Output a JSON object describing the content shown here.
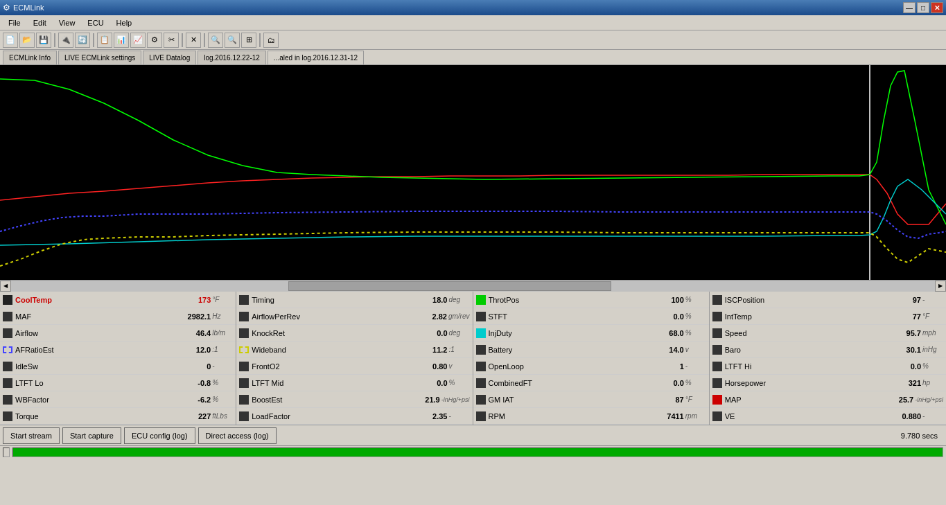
{
  "titlebar": {
    "title": "ECMLink",
    "min_label": "—",
    "max_label": "□",
    "close_label": "✕"
  },
  "menu": {
    "items": [
      "File",
      "Edit",
      "View",
      "ECU",
      "Help"
    ]
  },
  "tabs": [
    {
      "id": "ecmlink-info",
      "label": "ECMLink Info",
      "active": false
    },
    {
      "id": "live-settings",
      "label": "LIVE ECMLink settings",
      "active": false
    },
    {
      "id": "live-datalog",
      "label": "LIVE Datalog",
      "active": false
    },
    {
      "id": "log-dec22",
      "label": "log.2016.12.22-12",
      "active": false
    },
    {
      "id": "log-dec31",
      "label": "...aled in log.2016.12.31-12",
      "active": true
    }
  ],
  "data_fields": {
    "col1": [
      {
        "label": "CoolTemp",
        "value": "173",
        "unit": "°F",
        "highlight": true,
        "box_color": "dark"
      },
      {
        "label": "MAF",
        "value": "2982.1",
        "unit": "Hz",
        "highlight": false,
        "box_color": "dark"
      },
      {
        "label": "Airflow",
        "value": "46.4",
        "unit": "lb/m",
        "highlight": false,
        "box_color": "dark"
      },
      {
        "label": "AFRatioEst",
        "value": "12.0",
        "unit": ":1",
        "highlight": false,
        "box_color": "blue-dot"
      },
      {
        "label": "IdleSw",
        "value": "0",
        "unit": "-",
        "highlight": false,
        "box_color": "dark"
      },
      {
        "label": "LTFT Lo",
        "value": "-0.8",
        "unit": "%",
        "highlight": false,
        "box_color": "dark"
      },
      {
        "label": "WBFactor",
        "value": "-6.2",
        "unit": "%",
        "highlight": false,
        "box_color": "dark"
      },
      {
        "label": "Torque",
        "value": "227",
        "unit": "ftLbs",
        "highlight": false,
        "box_color": "dark"
      }
    ],
    "col2": [
      {
        "label": "Timing",
        "value": "18.0",
        "unit": "deg",
        "highlight": false,
        "box_color": "dark"
      },
      {
        "label": "AirflowPerRev",
        "value": "2.82",
        "unit": "gm/rev",
        "highlight": false,
        "box_color": "dark"
      },
      {
        "label": "KnockRet",
        "value": "0.0",
        "unit": "deg",
        "highlight": false,
        "box_color": "dark"
      },
      {
        "label": "Wideband",
        "value": "11.2",
        "unit": ":1",
        "highlight": false,
        "box_color": "yellow-dot"
      },
      {
        "label": "FrontO2",
        "value": "0.80",
        "unit": "v",
        "highlight": false,
        "box_color": "dark"
      },
      {
        "label": "LTFT Mid",
        "value": "0.0",
        "unit": "%",
        "highlight": false,
        "box_color": "dark"
      },
      {
        "label": "BoostEst",
        "value": "21.9",
        "unit": "-inHg/+psi",
        "highlight": false,
        "box_color": "dark"
      },
      {
        "label": "LoadFactor",
        "value": "2.35",
        "unit": "-",
        "highlight": false,
        "box_color": "dark"
      }
    ],
    "col3": [
      {
        "label": "ThrotPos",
        "value": "100",
        "unit": "%",
        "highlight": false,
        "box_color": "green"
      },
      {
        "label": "STFT",
        "value": "0.0",
        "unit": "%",
        "highlight": false,
        "box_color": "dark"
      },
      {
        "label": "InjDuty",
        "value": "68.0",
        "unit": "%",
        "highlight": false,
        "box_color": "cyan"
      },
      {
        "label": "Battery",
        "value": "14.0",
        "unit": "v",
        "highlight": false,
        "box_color": "dark"
      },
      {
        "label": "OpenLoop",
        "value": "1",
        "unit": "-",
        "highlight": false,
        "box_color": "dark"
      },
      {
        "label": "CombinedFT",
        "value": "0.0",
        "unit": "%",
        "highlight": false,
        "box_color": "dark"
      },
      {
        "label": "GM IAT",
        "value": "87",
        "unit": "°F",
        "highlight": false,
        "box_color": "dark"
      },
      {
        "label": "RPM",
        "value": "7411",
        "unit": "rpm",
        "highlight": false,
        "box_color": "dark"
      }
    ],
    "col4": [
      {
        "label": "ISCPosition",
        "value": "97",
        "unit": "-",
        "highlight": false,
        "box_color": "dark"
      },
      {
        "label": "IntTemp",
        "value": "77",
        "unit": "°F",
        "highlight": false,
        "box_color": "dark"
      },
      {
        "label": "Speed",
        "value": "95.7",
        "unit": "mph",
        "highlight": false,
        "box_color": "dark"
      },
      {
        "label": "Baro",
        "value": "30.1",
        "unit": "inHg",
        "highlight": false,
        "box_color": "dark"
      },
      {
        "label": "LTFT Hi",
        "value": "0.0",
        "unit": "%",
        "highlight": false,
        "box_color": "dark"
      },
      {
        "label": "Horsepower",
        "value": "321",
        "unit": "hp",
        "highlight": false,
        "box_color": "dark"
      },
      {
        "label": "MAP",
        "value": "25.7",
        "unit": "-inHg/+psi",
        "highlight": false,
        "box_color": "red"
      },
      {
        "label": "VE",
        "value": "0.880",
        "unit": "-",
        "highlight": false,
        "box_color": "dark"
      }
    ]
  },
  "buttons": {
    "start_stream": "Start stream",
    "start_capture": "Start capture",
    "ecu_config": "ECU config (log)",
    "direct_access": "Direct access (log)"
  },
  "status": {
    "time": "9.780 secs"
  }
}
